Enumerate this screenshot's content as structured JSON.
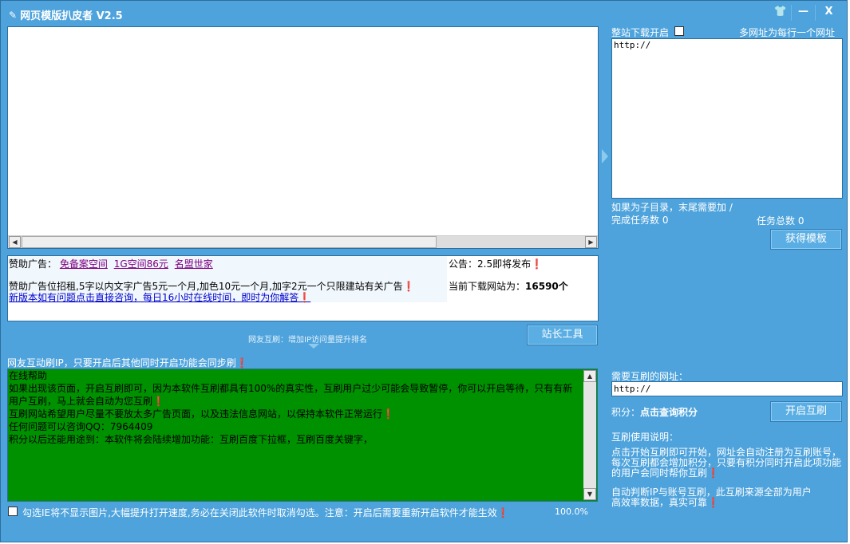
{
  "window": {
    "title": "网页模版扒皮者 V2.5",
    "buttons": {
      "skin": "👕",
      "minimize": "—",
      "close": "X"
    }
  },
  "browser": {
    "scroll_left": "◀",
    "scroll_right": "▶"
  },
  "ads": {
    "sponsor_label": "赞助广告：",
    "links": [
      "免备案空间",
      "1G空间86元",
      "名盟世家"
    ],
    "rent_text": "赞助广告位招租,5字以内文字广告5元一个月,加色10元一个月,加字2元一个只限建站有关广告❗",
    "consult_link": "新版本如有问题点击直接咨询，每日16小时在线时间，即时为你解答❗",
    "notice": "公告：2.5即将发布❗",
    "download_count_label": "当前下载网站为：",
    "download_count": "16590个"
  },
  "tools_button": "站长工具",
  "promo_caption": "网友互刷：增加IP访问量提升排名",
  "mutual_hint": "网友互动刷IP，只要开启后其他同时开启功能会同步刷❗",
  "help": {
    "lines": [
      "在线帮助",
      "如果出现该页面，开启互刷即可，因为本软件互刷都具有100%的真实性，互刷用户过少可能会导致暂停，你可以开启等待，只有有新用户互刷，马上就会自动为您互刷❗",
      "互刷网站希望用户尽量不要放太多广告页面，以及违法信息网站，以保持本软件正常运行❗",
      "任何问题可以咨询QQ：7964409",
      "积分以后还能用途到：本软件将会陆续增加功能：互刷百度下拉框，互刷百度关键字，"
    ]
  },
  "footer": {
    "no_images_label": "勾选IE将不显示图片,大幅提升打开速度,务必在关闭此软件时取消勾选。注意：开启后需要重新开启软件才能生效❗",
    "zoom": "100.0%"
  },
  "download": {
    "whole_site_label": "整站下载开启",
    "multi_url_hint": "多网址为每行一个网址",
    "urls_value": "http://",
    "subdir_hint": "如果为子目录，末尾需要加 /",
    "done_label": "完成任务数",
    "done": "0",
    "total_label": "任务总数",
    "total": "0",
    "get_button": "获得模板"
  },
  "mutual": {
    "url_label": "需要互刷的网址：",
    "url_value": "http://",
    "points_label": "积分：",
    "points_link": "点击查询积分",
    "start_button": "开启互刷",
    "instructions_title": "互刷使用说明：",
    "instructions_1": "点击开始互刷即可开始，网址会自动注册为互刷账号，每次互刷都会增加积分，只要有积分同时开启此项功能的用户会同时帮你互刷❗",
    "instructions_2": "自动判断IP与账号互刷，此互刷来源全部为用户高效率数据，真实可靠❗"
  }
}
